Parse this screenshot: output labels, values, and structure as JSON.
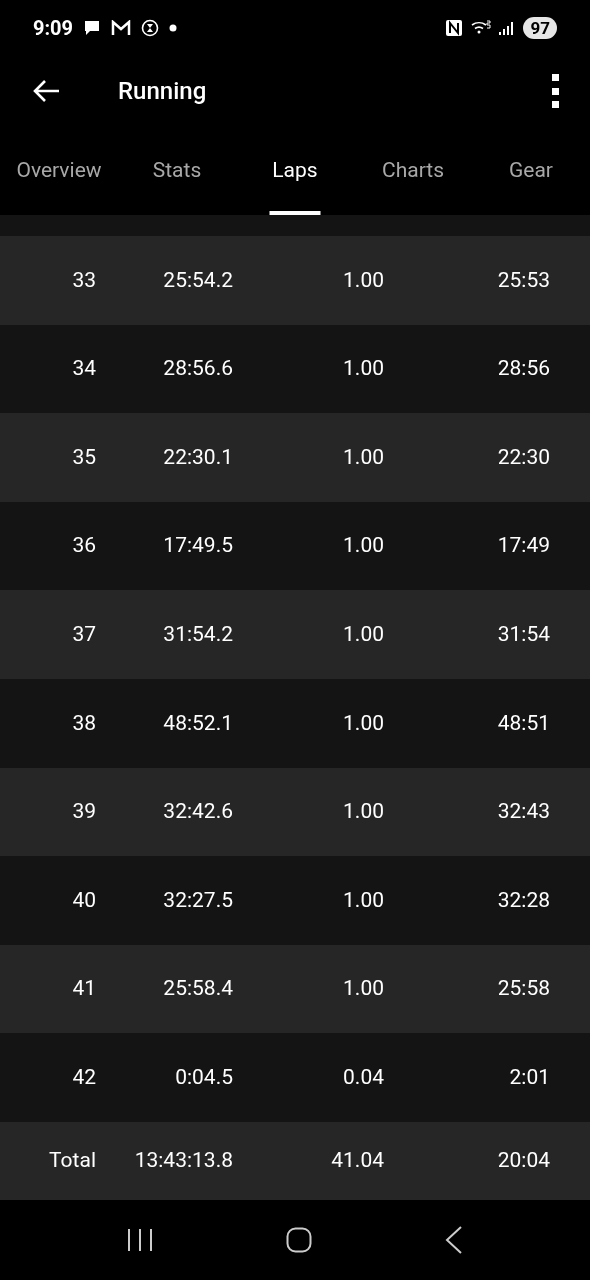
{
  "status_bar": {
    "time": "9:09",
    "battery": "97"
  },
  "app_bar": {
    "title": "Running"
  },
  "tabs": [
    {
      "label": "Overview",
      "selected": false
    },
    {
      "label": "Stats",
      "selected": false
    },
    {
      "label": "Laps",
      "selected": true
    },
    {
      "label": "Charts",
      "selected": false
    },
    {
      "label": "Gear",
      "selected": false
    }
  ],
  "laps": [
    [
      "33",
      "25:54.2",
      "1.00",
      "25:53"
    ],
    [
      "34",
      "28:56.6",
      "1.00",
      "28:56"
    ],
    [
      "35",
      "22:30.1",
      "1.00",
      "22:30"
    ],
    [
      "36",
      "17:49.5",
      "1.00",
      "17:49"
    ],
    [
      "37",
      "31:54.2",
      "1.00",
      "31:54"
    ],
    [
      "38",
      "48:52.1",
      "1.00",
      "48:51"
    ],
    [
      "39",
      "32:42.6",
      "1.00",
      "32:43"
    ],
    [
      "40",
      "32:27.5",
      "1.00",
      "32:28"
    ],
    [
      "41",
      "25:58.4",
      "1.00",
      "25:58"
    ],
    [
      "42",
      "0:04.5",
      "0.04",
      "2:01"
    ]
  ],
  "total": [
    "Total",
    "13:43:13.8",
    "41.04",
    "20:04"
  ]
}
